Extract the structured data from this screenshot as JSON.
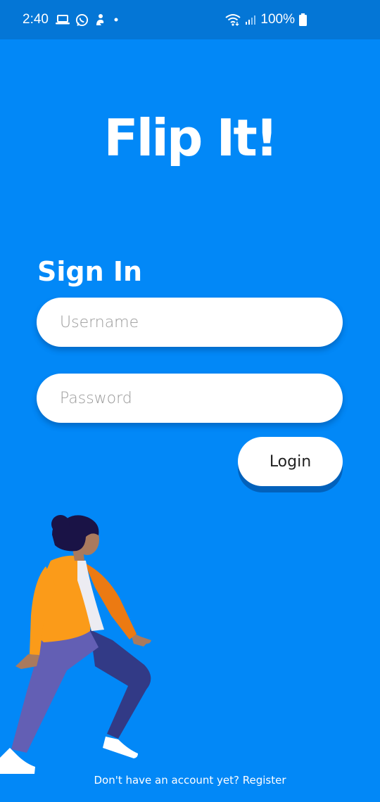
{
  "status_bar": {
    "time": "2:40",
    "battery_text": "100%",
    "icons_left": [
      "laptop-icon",
      "whatsapp-icon",
      "notification-app-icon",
      "dot-icon"
    ],
    "icons_right": [
      "wifi-icon",
      "signal-icon",
      "battery-icon"
    ]
  },
  "app": {
    "title": "Flip It!",
    "background_color": "#0288f7",
    "status_bar_color": "#0476d6"
  },
  "signin": {
    "heading": "Sign In",
    "username_placeholder": "Username",
    "username_value": "",
    "password_placeholder": "Password",
    "password_value": "",
    "login_label": "Login"
  },
  "illustration": {
    "name": "walking-person-illustration",
    "colors": {
      "hair": "#1a1346",
      "skin": "#a97a5e",
      "jacket": "#fb9b19",
      "jacket_shadow": "#ec7a12",
      "shirt": "#ececf2",
      "pants_front": "#635fb4",
      "pants_back": "#323a86",
      "shoes": "#ffffff"
    }
  },
  "footer": {
    "register_text": "Don't have an account yet? Register"
  }
}
